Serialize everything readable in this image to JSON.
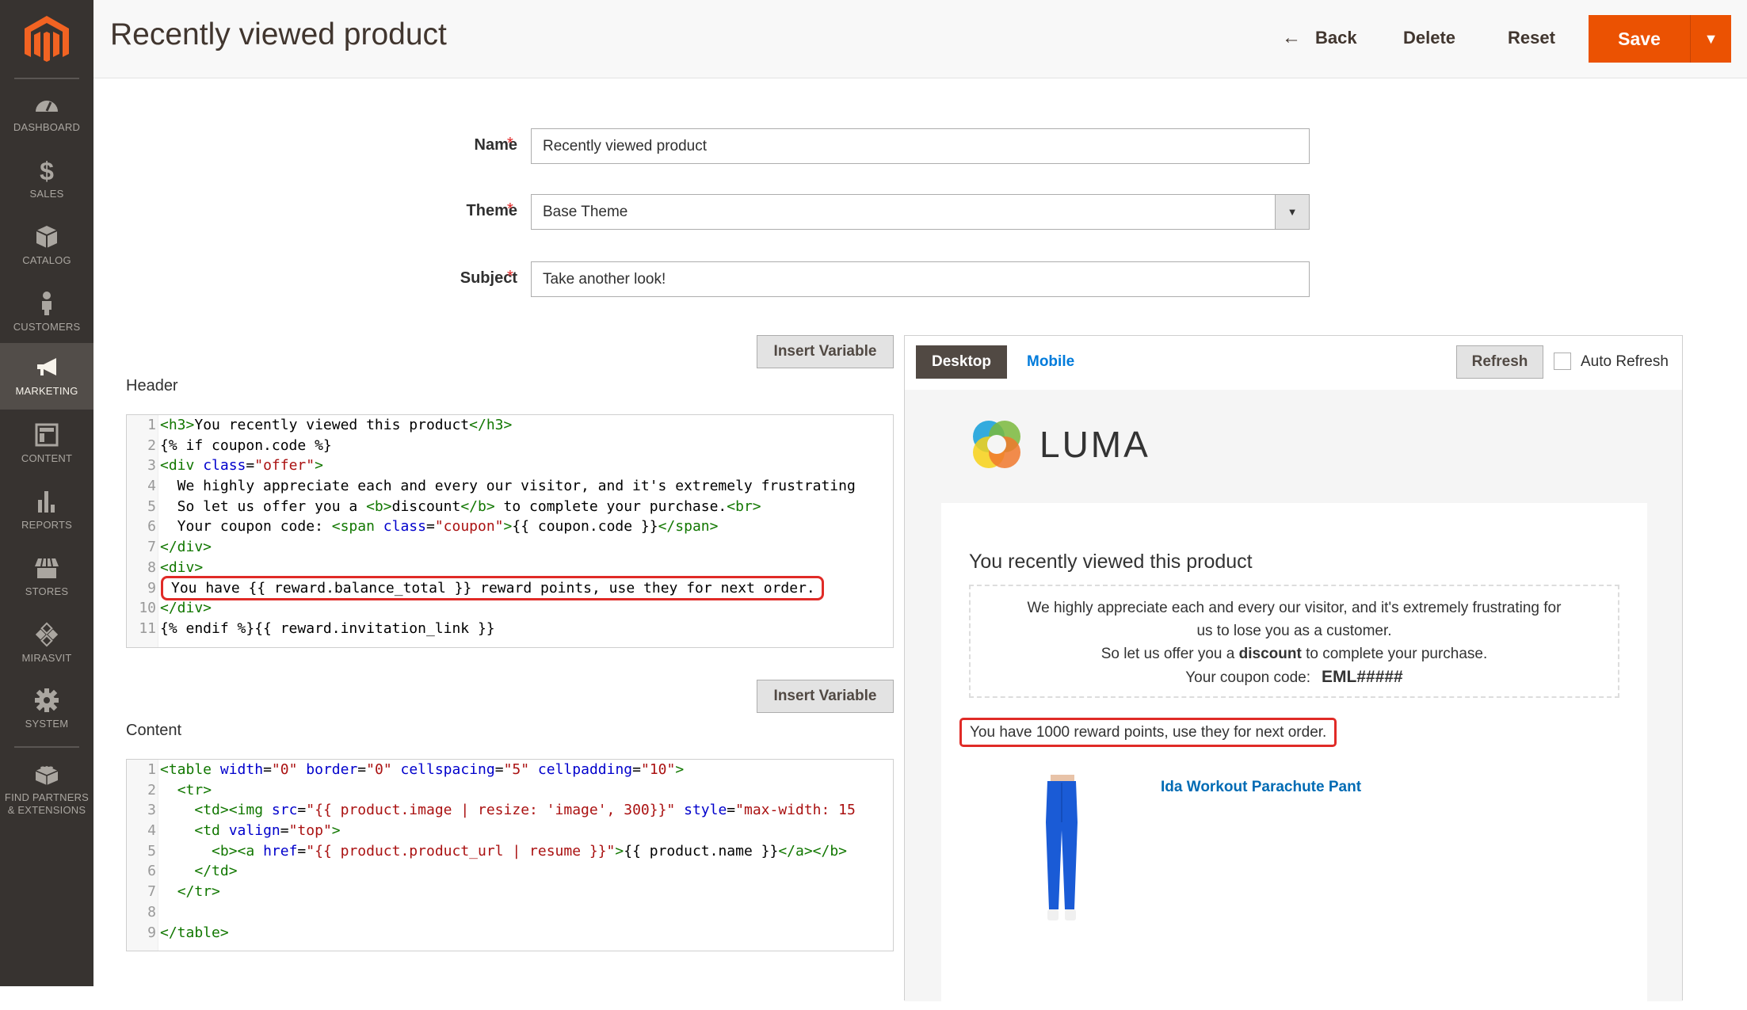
{
  "sidebar": {
    "items": [
      {
        "label": "DASHBOARD",
        "icon": "dashboard-icon",
        "active": false
      },
      {
        "label": "SALES",
        "icon": "dollar-icon",
        "active": false
      },
      {
        "label": "CATALOG",
        "icon": "box-icon",
        "active": false
      },
      {
        "label": "CUSTOMERS",
        "icon": "person-icon",
        "active": false
      },
      {
        "label": "MARKETING",
        "icon": "megaphone-icon",
        "active": true
      },
      {
        "label": "CONTENT",
        "icon": "layout-icon",
        "active": false
      },
      {
        "label": "REPORTS",
        "icon": "bar-chart-icon",
        "active": false
      },
      {
        "label": "STORES",
        "icon": "storefront-icon",
        "active": false
      },
      {
        "label": "MIRASVIT",
        "icon": "mirasvit-icon",
        "active": false
      },
      {
        "label": "SYSTEM",
        "icon": "gear-icon",
        "active": false
      },
      {
        "label": "FIND PARTNERS & EXTENSIONS",
        "icon": "lego-brick-icon",
        "active": false
      }
    ]
  },
  "header": {
    "title": "Recently viewed product",
    "back_label": "Back",
    "delete_label": "Delete",
    "reset_label": "Reset",
    "save_label": "Save"
  },
  "form": {
    "name": {
      "label": "Name",
      "value": "Recently viewed product",
      "required": true
    },
    "theme": {
      "label": "Theme",
      "value": "Base Theme",
      "required": true
    },
    "subject": {
      "label": "Subject",
      "value": "Take another look!",
      "required": true
    }
  },
  "header_editor": {
    "label": "Header",
    "insert_variable_label": "Insert Variable",
    "line_numbers": [
      "1",
      "2",
      "3",
      "4",
      "5",
      "6",
      "7",
      "8",
      "9",
      "10",
      "11"
    ]
  },
  "content_editor": {
    "label": "Content",
    "insert_variable_label": "Insert Variable",
    "line_numbers": [
      "1",
      "2",
      "3",
      "4",
      "5",
      "6",
      "7",
      "8",
      "9"
    ]
  },
  "preview": {
    "tabs": {
      "desktop": "Desktop",
      "mobile": "Mobile"
    },
    "refresh_label": "Refresh",
    "auto_refresh_label": "Auto Refresh",
    "auto_refresh_checked": false,
    "brand": "LUMA",
    "heading": "You recently viewed this product",
    "offer_line1": "We highly appreciate each and every our visitor, and it's extremely frustrating for",
    "offer_line2": "us to lose you as a customer.",
    "offer_line3_pre": "So let us offer you a ",
    "offer_line3_bold": "discount",
    "offer_line3_post": " to complete your purchase.",
    "coupon_label": "Your coupon code:",
    "coupon_code": "EML#####",
    "reward_text": "You have 1000 reward points, use they for next order.",
    "product_name": "Ida Workout Parachute Pant"
  },
  "colors": {
    "accent": "#eb5202",
    "sidebar_bg": "#373330",
    "highlight": "#e02b27",
    "link": "#006bb4"
  }
}
